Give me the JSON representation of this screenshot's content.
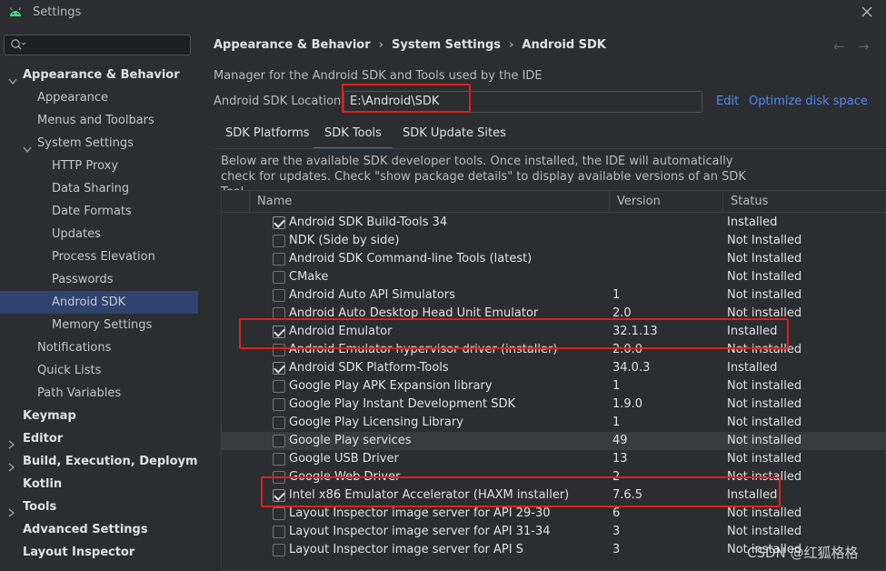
{
  "window": {
    "title": "Settings"
  },
  "search": {
    "placeholder": ""
  },
  "sidebar": {
    "items": [
      {
        "label": "Appearance & Behavior",
        "level": 0,
        "bold": true,
        "expanded": true
      },
      {
        "label": "Appearance",
        "level": 1
      },
      {
        "label": "Menus and Toolbars",
        "level": 1
      },
      {
        "label": "System Settings",
        "level": 1,
        "expanded": true
      },
      {
        "label": "HTTP Proxy",
        "level": 2
      },
      {
        "label": "Data Sharing",
        "level": 2
      },
      {
        "label": "Date Formats",
        "level": 2
      },
      {
        "label": "Updates",
        "level": 2
      },
      {
        "label": "Process Elevation",
        "level": 2
      },
      {
        "label": "Passwords",
        "level": 2
      },
      {
        "label": "Android SDK",
        "level": 2,
        "selected": true
      },
      {
        "label": "Memory Settings",
        "level": 2
      },
      {
        "label": "Notifications",
        "level": 1
      },
      {
        "label": "Quick Lists",
        "level": 1
      },
      {
        "label": "Path Variables",
        "level": 1
      },
      {
        "label": "Keymap",
        "level": 0,
        "bold": true
      },
      {
        "label": "Editor",
        "level": 0,
        "bold": true,
        "collapsed": true
      },
      {
        "label": "Build, Execution, Deployment",
        "level": 0,
        "bold": true,
        "collapsed": true
      },
      {
        "label": "Kotlin",
        "level": 0,
        "bold": true
      },
      {
        "label": "Tools",
        "level": 0,
        "bold": true,
        "collapsed": true
      },
      {
        "label": "Advanced Settings",
        "level": 0,
        "bold": true
      },
      {
        "label": "Layout Inspector",
        "level": 0,
        "bold": true
      }
    ]
  },
  "breadcrumb": [
    "Appearance & Behavior",
    "System Settings",
    "Android SDK"
  ],
  "main": {
    "description": "Manager for the Android SDK and Tools used by the IDE",
    "location_label": "Android SDK Location:",
    "location_value": "E:\\Android\\SDK",
    "edit_label": "Edit",
    "optimize_label": "Optimize disk space",
    "tabs": [
      {
        "label": "SDK Platforms",
        "active": false
      },
      {
        "label": "SDK Tools",
        "active": true
      },
      {
        "label": "SDK Update Sites",
        "active": false
      }
    ],
    "info_text": "Below are the available SDK developer tools. Once installed, the IDE will automatically check for updates. Check \"show package details\" to display available versions of an SDK Tool."
  },
  "table": {
    "headers": [
      "Name",
      "Version",
      "Status"
    ],
    "rows": [
      {
        "name": "Android SDK Build-Tools 34",
        "version": "",
        "status": "Installed",
        "checked": true
      },
      {
        "name": "NDK (Side by side)",
        "version": "",
        "status": "Not Installed",
        "checked": false
      },
      {
        "name": "Android SDK Command-line Tools (latest)",
        "version": "",
        "status": "Not Installed",
        "checked": false
      },
      {
        "name": "CMake",
        "version": "",
        "status": "Not Installed",
        "checked": false
      },
      {
        "name": "Android Auto API Simulators",
        "version": "1",
        "status": "Not installed",
        "checked": false
      },
      {
        "name": "Android Auto Desktop Head Unit Emulator",
        "version": "2.0",
        "status": "Not installed",
        "checked": false
      },
      {
        "name": "Android Emulator",
        "version": "32.1.13",
        "status": "Installed",
        "checked": true
      },
      {
        "name": "Android Emulator hypervisor driver (installer)",
        "version": "2.0.0",
        "status": "Not installed",
        "checked": false
      },
      {
        "name": "Android SDK Platform-Tools",
        "version": "34.0.3",
        "status": "Installed",
        "checked": true
      },
      {
        "name": "Google Play APK Expansion library",
        "version": "1",
        "status": "Not installed",
        "checked": false
      },
      {
        "name": "Google Play Instant Development SDK",
        "version": "1.9.0",
        "status": "Not installed",
        "checked": false
      },
      {
        "name": "Google Play Licensing Library",
        "version": "1",
        "status": "Not installed",
        "checked": false
      },
      {
        "name": "Google Play services",
        "version": "49",
        "status": "Not installed",
        "checked": false,
        "highlighted": true
      },
      {
        "name": "Google USB Driver",
        "version": "13",
        "status": "Not installed",
        "checked": false
      },
      {
        "name": "Google Web Driver",
        "version": "2",
        "status": "Not installed",
        "checked": false
      },
      {
        "name": "Intel x86 Emulator Accelerator (HAXM installer)",
        "version": "7.6.5",
        "status": "Installed",
        "checked": true
      },
      {
        "name": "Layout Inspector image server for API 29-30",
        "version": "6",
        "status": "Not installed",
        "checked": false
      },
      {
        "name": "Layout Inspector image server for API 31-34",
        "version": "3",
        "status": "Not installed",
        "checked": false
      },
      {
        "name": "Layout Inspector image server for API S",
        "version": "3",
        "status": "Not installed",
        "checked": false
      }
    ]
  },
  "watermark": "CSDN @红狐格格",
  "colors": {
    "accent": "#3574f0",
    "link": "#548af7",
    "selection": "#2e436e",
    "annotation": "#e0201c"
  }
}
